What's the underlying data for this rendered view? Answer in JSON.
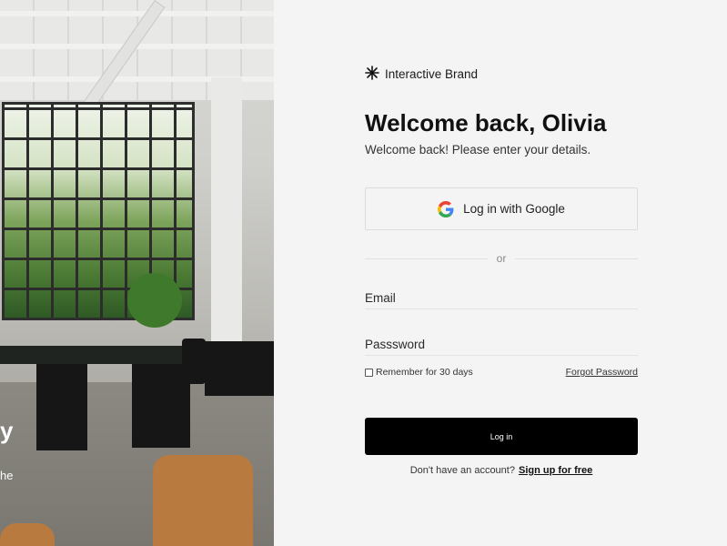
{
  "photo": {
    "tagline_fragment_1": "y",
    "tagline_fragment_2": "he"
  },
  "brand": {
    "icon": "asterisk-icon",
    "name": "Interactive Brand"
  },
  "header": {
    "title": "Welcome back, Olivia",
    "subtitle": "Welcome back! Please enter your details."
  },
  "google": {
    "icon": "google-icon",
    "label": "Log in with Google"
  },
  "divider": {
    "label": "or"
  },
  "form": {
    "email_placeholder": "Email",
    "password_placeholder": "Passsword",
    "remember_label": "Remember for 30 days",
    "forgot_label": "Forgot Password",
    "login_label": "Log in"
  },
  "signup": {
    "prompt": "Don't have an account?",
    "link": "Sign up for free"
  },
  "colors": {
    "background": "#f4f4f4",
    "primary_button": "#000000",
    "google_blue": "#4285F4",
    "google_red": "#EA4335",
    "google_yellow": "#FBBC05",
    "google_green": "#34A853"
  }
}
